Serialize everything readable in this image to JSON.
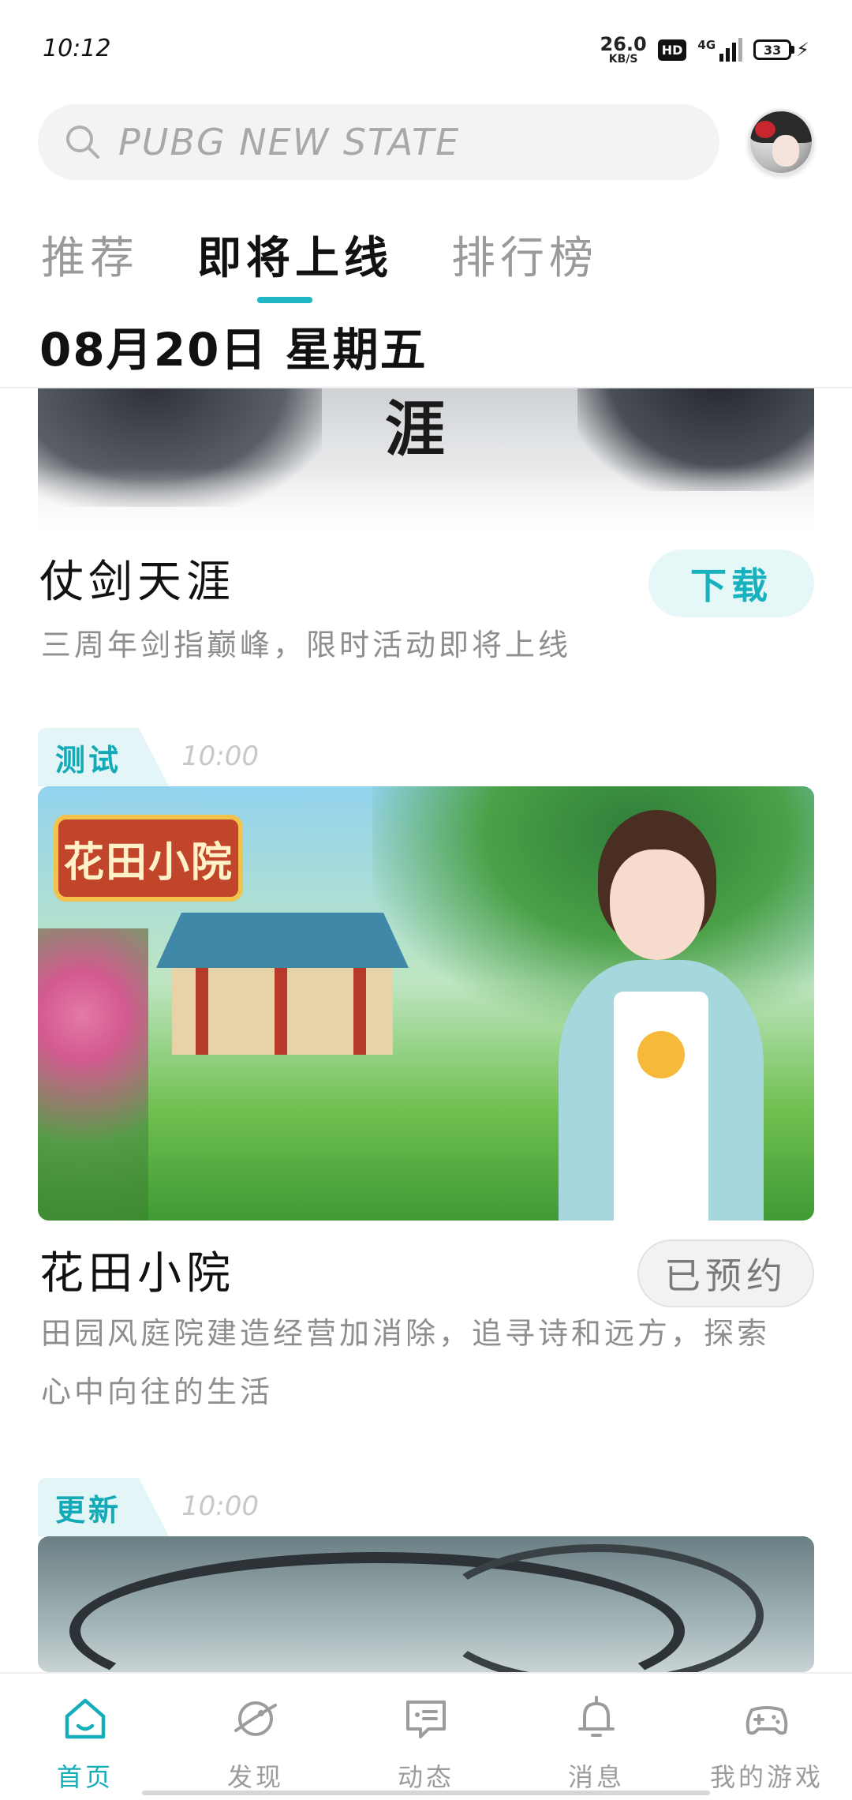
{
  "status_bar": {
    "time": "10:12",
    "net_speed_value": "26.0",
    "net_speed_unit": "KB/S",
    "hd_badge": "HD",
    "network": "4G",
    "battery": "33"
  },
  "search": {
    "placeholder": "PUBG NEW STATE",
    "icon": "search-icon"
  },
  "tabs": [
    {
      "label": "推荐",
      "active": false
    },
    {
      "label": "即将上线",
      "active": true
    },
    {
      "label": "排行榜",
      "active": false
    }
  ],
  "date_label": "08月20日 星期五",
  "games": [
    {
      "title": "仗剑天涯",
      "button": "下载",
      "description": "三周年剑指巅峰，限时活动即将上线",
      "banner_text": "涯"
    },
    {
      "tag": "测试",
      "time": "10:00",
      "title": "花田小院",
      "button": "已预约",
      "description": "田园风庭院建造经营加消除，追寻诗和远方，探索心中向往的生活",
      "banner_logo": "花田小院"
    },
    {
      "tag": "更新",
      "time": "10:00"
    }
  ],
  "bottom_nav": [
    {
      "label": "首页",
      "icon": "home-icon",
      "active": true
    },
    {
      "label": "发现",
      "icon": "planet-icon",
      "active": false
    },
    {
      "label": "动态",
      "icon": "chat-icon",
      "active": false
    },
    {
      "label": "消息",
      "icon": "bell-icon",
      "active": false
    },
    {
      "label": "我的游戏",
      "icon": "gamepad-icon",
      "active": false
    }
  ],
  "colors": {
    "accent": "#16adbb",
    "tag_bg": "#e3f5f6",
    "muted_text": "#8e8e8e"
  }
}
